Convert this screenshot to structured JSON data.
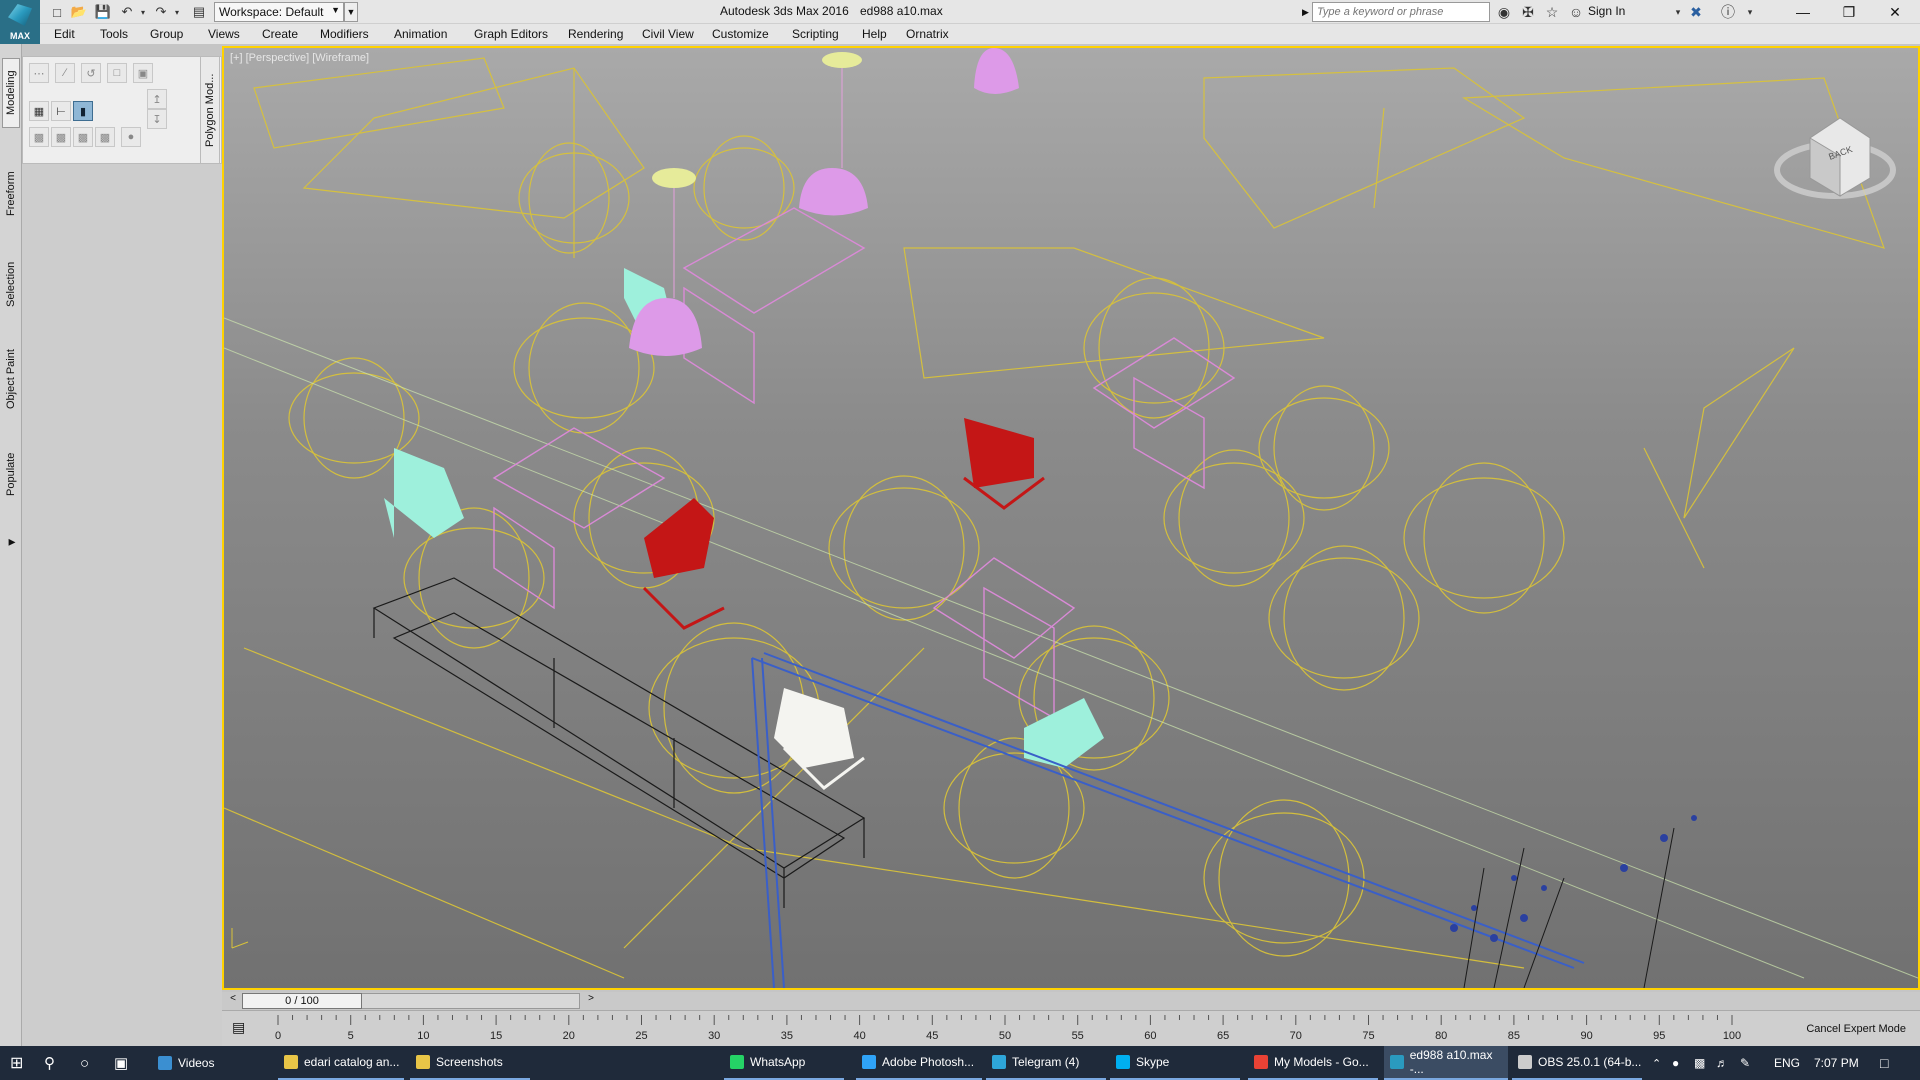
{
  "titlebar": {
    "app_badge": "MAX",
    "workspace": "Workspace: Default",
    "app_title": "Autodesk 3ds Max 2016",
    "file_title": "ed988 a10.max",
    "search_placeholder": "Type a keyword or phrase",
    "sign_in": "Sign In"
  },
  "menu": [
    "Edit",
    "Tools",
    "Group",
    "Views",
    "Create",
    "Modifiers",
    "Animation",
    "Graph Editors",
    "Rendering",
    "Civil View",
    "Customize",
    "Scripting",
    "Help",
    "Ornatrix"
  ],
  "ribbon": {
    "tabs": [
      "Modeling",
      "Freeform",
      "Selection",
      "Object Paint",
      "Populate"
    ],
    "panel_label": "Polygon Mod..."
  },
  "viewport": {
    "label": "[+] [Perspective] [Wireframe]",
    "viewcube_face": "BACK"
  },
  "timeline": {
    "position": "0 / 100",
    "ticks": [
      "0",
      "5",
      "10",
      "15",
      "20",
      "25",
      "30",
      "35",
      "40",
      "45",
      "50",
      "55",
      "60",
      "65",
      "70",
      "75",
      "80",
      "85",
      "90",
      "95",
      "100"
    ],
    "cancel_expert": "Cancel Expert Mode"
  },
  "taskbar": {
    "items": [
      {
        "label": "Videos",
        "color": "#3b8fd1"
      },
      {
        "label": "edari catalog an...",
        "color": "#e8c547"
      },
      {
        "label": "Screenshots",
        "color": "#e8c547"
      },
      {
        "label": "WhatsApp",
        "color": "#25d366"
      },
      {
        "label": "Adobe Photosh...",
        "color": "#2fa3f7"
      },
      {
        "label": "Telegram (4)",
        "color": "#2ea6d9"
      },
      {
        "label": "Skype",
        "color": "#00aff0"
      },
      {
        "label": "My Models - Go...",
        "color": "#e94235"
      },
      {
        "label": "ed988 a10.max -...",
        "color": "#2a9abf"
      },
      {
        "label": "OBS 25.0.1 (64-b...",
        "color": "#cccccc"
      }
    ],
    "lang": "ENG",
    "time": "7:07 PM"
  },
  "colors": {
    "viewport_border": "#ffd200",
    "light_wire": "#e4c83a",
    "chair_cyan": "#9ef0dc",
    "chair_red": "#c41616",
    "lamp_pink": "#dd9ae8",
    "desk_pink": "#d98ad6"
  }
}
